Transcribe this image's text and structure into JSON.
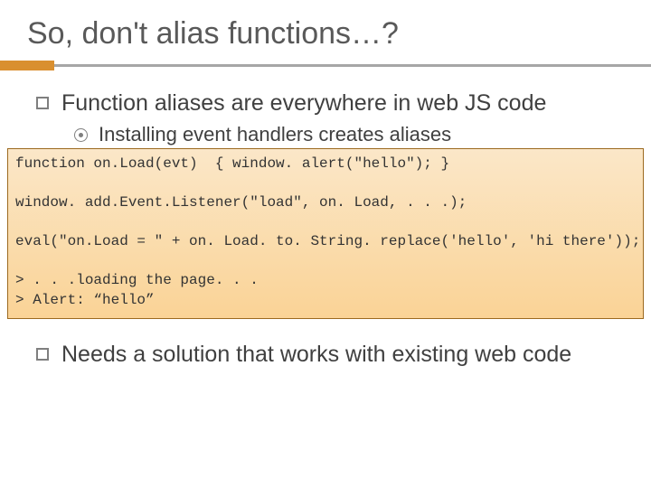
{
  "title": "So, don't alias functions…?",
  "bullet1": "Function aliases are everywhere in web JS code",
  "bullet2": "Installing event handlers creates aliases",
  "code": {
    "l1": "function on.Load(evt)  { window. alert(\"hello\"); }",
    "l2": "",
    "l3": "window. add.Event.Listener(\"load\", on. Load, . . .);",
    "l4": "",
    "l5": "eval(\"on.Load = \" + on. Load. to. String. replace('hello', 'hi there'));",
    "l6": "",
    "l7": "> . . .loading the page. . .",
    "l8": "> Alert: “hello”"
  },
  "bullet3": "Needs a solution that works with existing web code"
}
